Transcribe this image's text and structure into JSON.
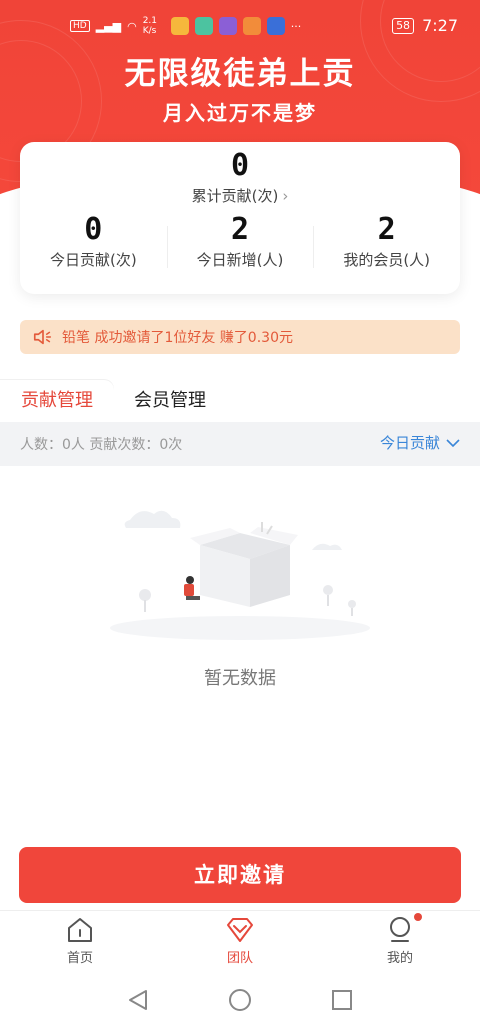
{
  "status_bar": {
    "net_speed": "2.1 K/s",
    "battery": "58",
    "time": "7:27"
  },
  "hero": {
    "title": "无限级徒弟上贡",
    "subtitle": "月入过万不是梦"
  },
  "summary": {
    "total_value": "0",
    "total_label": "累计贡献(次)",
    "stats": [
      {
        "value": "0",
        "label": "今日贡献(次)"
      },
      {
        "value": "2",
        "label": "今日新增(人)"
      },
      {
        "value": "2",
        "label": "我的会员(人)"
      }
    ]
  },
  "notice": {
    "text": "铅笔 成功邀请了1位好友 赚了0.30元"
  },
  "tabs": {
    "contribution": "贡献管理",
    "members": "会员管理"
  },
  "filter": {
    "info": "人数：0人 贡献次数：0次",
    "selected": "今日贡献"
  },
  "empty": {
    "text": "暂无数据"
  },
  "invite_button": "立即邀请",
  "bottom_nav": {
    "home": "首页",
    "team": "团队",
    "mine": "我的"
  },
  "colors": {
    "primary": "#f0463b",
    "link": "#3a86d8",
    "notice_bg": "#fbe1c8"
  }
}
